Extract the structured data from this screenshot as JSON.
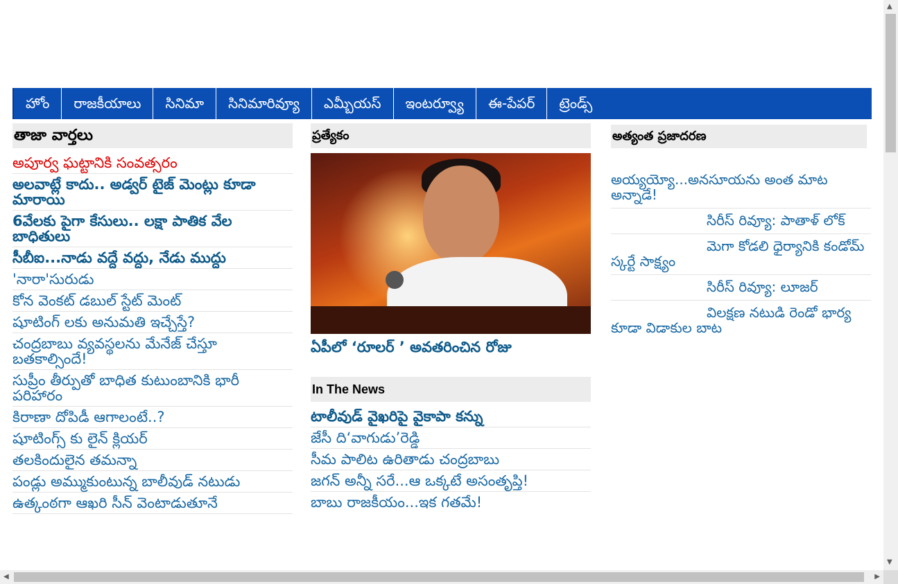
{
  "nav": {
    "items": [
      "హోం",
      "రాజకీయాలు",
      "సినిమా",
      "సినిమారివ్యూ",
      "ఎమ్బీయస్",
      "ఇంటర్వ్యూ",
      "ఈ-పేపర్",
      "ట్రెండ్స్"
    ]
  },
  "latest": {
    "heading": "తాజా వార్తలు",
    "items": [
      "అపూర్వ ఘట్టానికి సంవత్సరం",
      "అలవాట్లే కాదు.. అడ్వర్ టైజ్ మెంట్లు కూడా మారాయి",
      "6వేలకు పైగా కేసులు.. లక్షా పాతిక వేల బాధితులు",
      "సీబీఐ...నాడు వద్దే వద్దు, నేడు ముద్దు",
      "'నారా'సురుడు",
      "కోన వెంకట్ డబుల్ స్టేట్ మెంట్",
      "షూటింగ్ లకు అనుమతి ఇచ్చేస్తే?",
      "చంద్రబాబు వ్యవస్థలను మేనేజ్ చేస్తూ బతకాల్సిందే!",
      "సుప్రీం తీర్పుతో బాధిత కుటుంబానికి భారీ పరిహారం",
      "కిరాణా దోపిడీ ఆగాలంటే..?",
      "షూటింగ్స్ కు లైన్ క్లియర్",
      "తలకిందులైన తమన్నా",
      "పండ్లు అమ్ముకుంటున్న బాలీవుడ్ నటుడు",
      "ఉత్కంఠగా ఆఖరి సీన్ వెంటాడుతూనే"
    ]
  },
  "special": {
    "heading": "ప్రత్యేకం",
    "caption": "ఏపీలో ‘రూలర్ ’ అవతరించిన రోజు"
  },
  "in_news": {
    "heading": "In The News",
    "items": [
      "టాలీవుడ్ వైఖరిపై వైకాపా కన్ను",
      "జేసీ ది‘వాగుడు’రెడ్డి",
      "సీమ పాలిట ఉరితాడు చంద్రబాబు",
      "జగన్ అన్నీ సరే...ఆ ఒక్కటే అసంతృప్తి!",
      "బాబు రాజకీయం...ఇక గతమే!"
    ]
  },
  "popular": {
    "heading": "అత్యంత ప్రజాదరణ",
    "items": [
      "అయ్యయ్యో...అనసూయను అంత మాట అన్నాడే!",
      "సిరీస్ రివ్యూ: పాతాళ్ లోక్",
      "మెగా కోడలి ధైర్యానికి కండోమ్ స్కర్టే సాక్ష్యం",
      "సిరీస్ రివ్యూ: లూజర్",
      "విలక్షణ నటుడి రెండో భార్య కూడా విడాకుల బాట"
    ]
  },
  "colors": {
    "nav_bg": "#0b4fb5",
    "link": "#0e5a8a",
    "highlight": "#e00000",
    "section_bg": "#ececec"
  }
}
